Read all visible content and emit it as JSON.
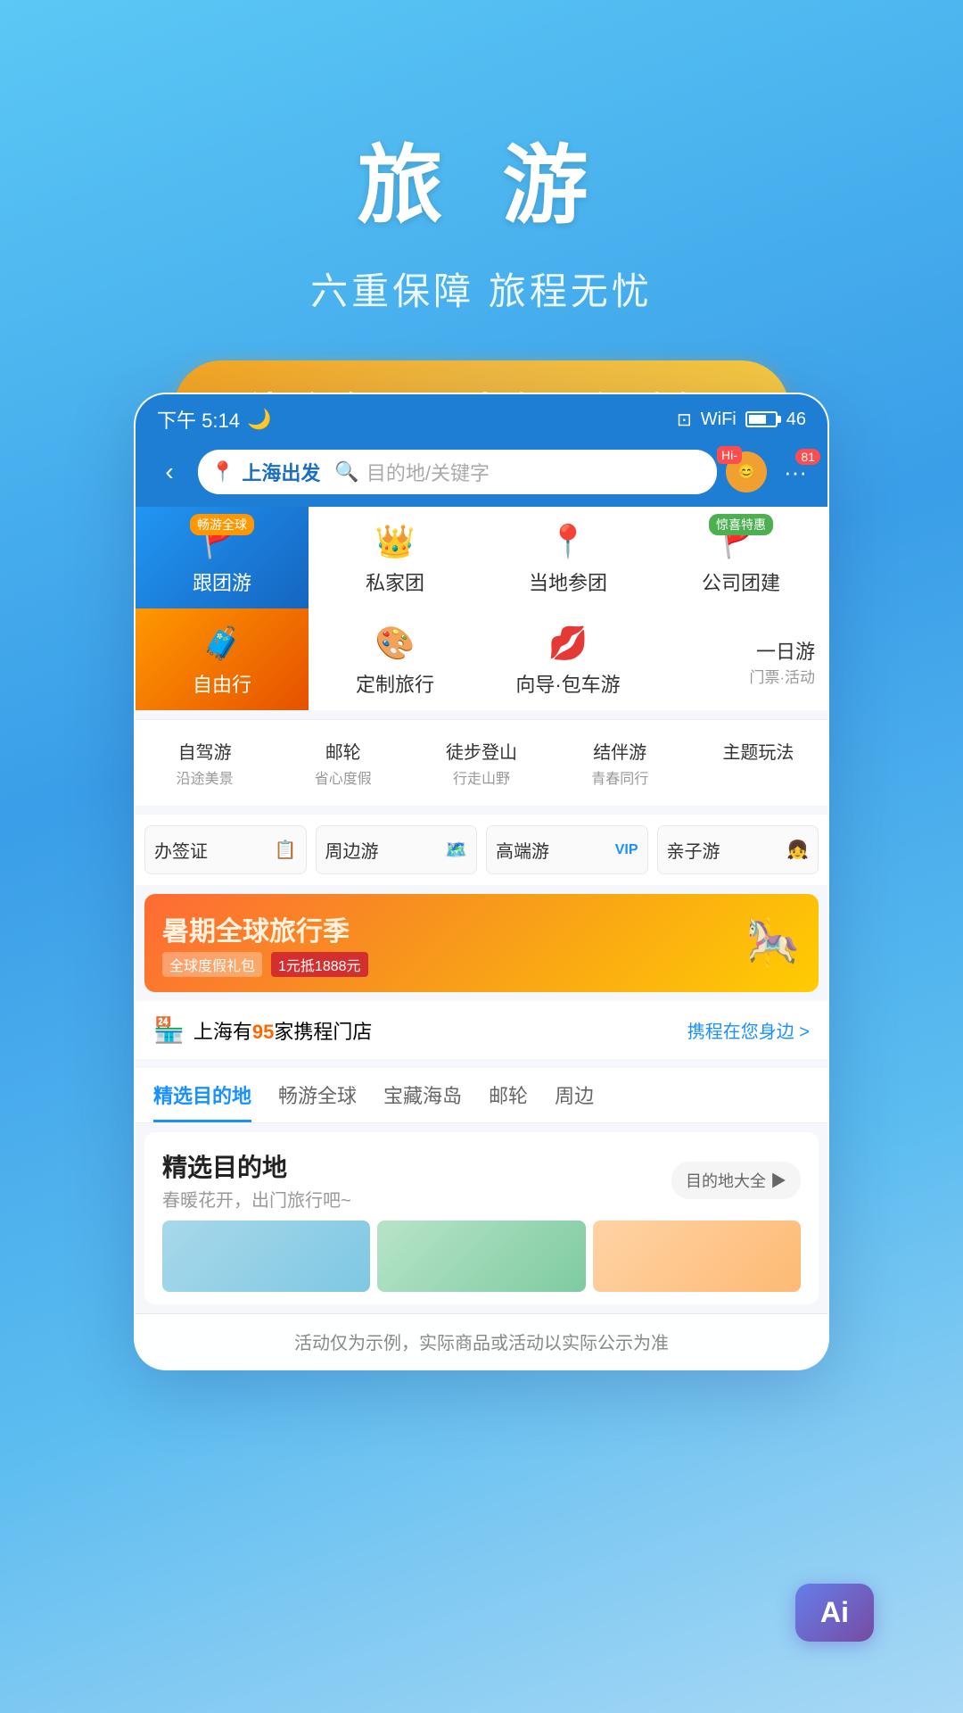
{
  "hero": {
    "title": "旅 游",
    "subtitle": "六重保障 旅程无忧",
    "promo": "线路全 / 玩法多 / 保障好"
  },
  "statusBar": {
    "time": "下午 5:14",
    "battery": "46"
  },
  "navBar": {
    "from": "上海出发",
    "searchPlaceholder": "目的地/关键字",
    "notificationCount": "81"
  },
  "menuGrid": {
    "items": [
      {
        "id": "group-tour",
        "label": "跟团游",
        "badge": "畅游全球",
        "badgeColor": "blue",
        "bg": "blue"
      },
      {
        "id": "private-tour",
        "label": "私家团",
        "badge": "",
        "bg": ""
      },
      {
        "id": "local-tour",
        "label": "当地参团",
        "badge": "",
        "bg": ""
      },
      {
        "id": "company-tour",
        "label": "公司团建",
        "badge": "惊喜特惠",
        "badgeColor": "green",
        "bg": ""
      },
      {
        "id": "free-tour",
        "label": "自由行",
        "badge": "",
        "bg": "orange"
      },
      {
        "id": "custom-tour",
        "label": "定制旅行",
        "badge": "",
        "bg": ""
      },
      {
        "id": "guide-tour",
        "label": "向导·包车游",
        "badge": "",
        "bg": ""
      },
      {
        "id": "day-tour",
        "label": "一日游",
        "sub": "门票·活动",
        "bg": ""
      }
    ]
  },
  "subMenu": {
    "items": [
      {
        "label": "自驾游",
        "sub": "沿途美景"
      },
      {
        "label": "邮轮",
        "sub": "省心度假"
      },
      {
        "label": "徒步登山",
        "sub": "行走山野"
      },
      {
        "label": "结伴游",
        "sub": "青春同行"
      },
      {
        "label": "主题玩法",
        "sub": ""
      }
    ]
  },
  "tagRow": {
    "items": [
      {
        "label": "办签证",
        "icon": "📋"
      },
      {
        "label": "周边游",
        "icon": "🗺️"
      },
      {
        "label": "高端游",
        "icon": "VIP"
      },
      {
        "label": "亲子游",
        "icon": "👨‍👧"
      }
    ]
  },
  "promoBanner": {
    "title": "暑期全球旅行季",
    "sub1": "全球度假礼包",
    "sub2": "1元抵1888元"
  },
  "storeInfo": {
    "prefix": "上海有",
    "count": "95",
    "suffix": "家携程门店",
    "link": "携程在您身边 >"
  },
  "tabs": [
    {
      "label": "精选目的地",
      "active": true
    },
    {
      "label": "畅游全球",
      "active": false
    },
    {
      "label": "宝藏海岛",
      "active": false
    },
    {
      "label": "邮轮",
      "active": false
    },
    {
      "label": "周边",
      "active": false
    }
  ],
  "destCard": {
    "title": "精选目的地",
    "sub": "春暖花开，出门旅行吧~",
    "btnLabel": "目的地大全 ▶"
  },
  "disclaimer": "活动仅为示例，实际商品或活动以实际公示为准",
  "aiBadge": "Ai"
}
